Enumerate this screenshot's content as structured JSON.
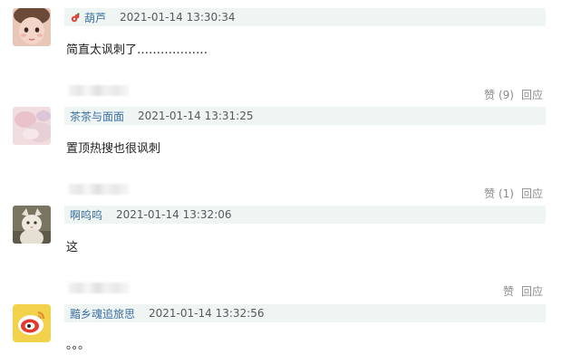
{
  "comments": [
    {
      "name": "葫芦",
      "time": "2021-01-14 13:30:34",
      "text": "简直太讽刺了………………",
      "like": "",
      "reply": ""
    },
    {
      "name": "茶茶与面面",
      "time": "2021-01-14 13:31:25",
      "text": "置顶热搜也很讽刺",
      "like": "赞 (9)",
      "reply": "回应"
    },
    {
      "name": "啊呜呜",
      "time": "2021-01-14 13:32:06",
      "text": "这",
      "like": "赞 (1)",
      "reply": "回应"
    },
    {
      "name": "黯乡魂追旅思",
      "time": "2021-01-14 13:32:56",
      "text": "。。。",
      "like": "赞",
      "reply": "回应"
    }
  ],
  "icons": {
    "vip_badge": "gourd-badge-icon"
  },
  "colors": {
    "meta_bar": "#eef5f3",
    "username": "#3b6fa0",
    "action_text": "#8a8a8a"
  }
}
